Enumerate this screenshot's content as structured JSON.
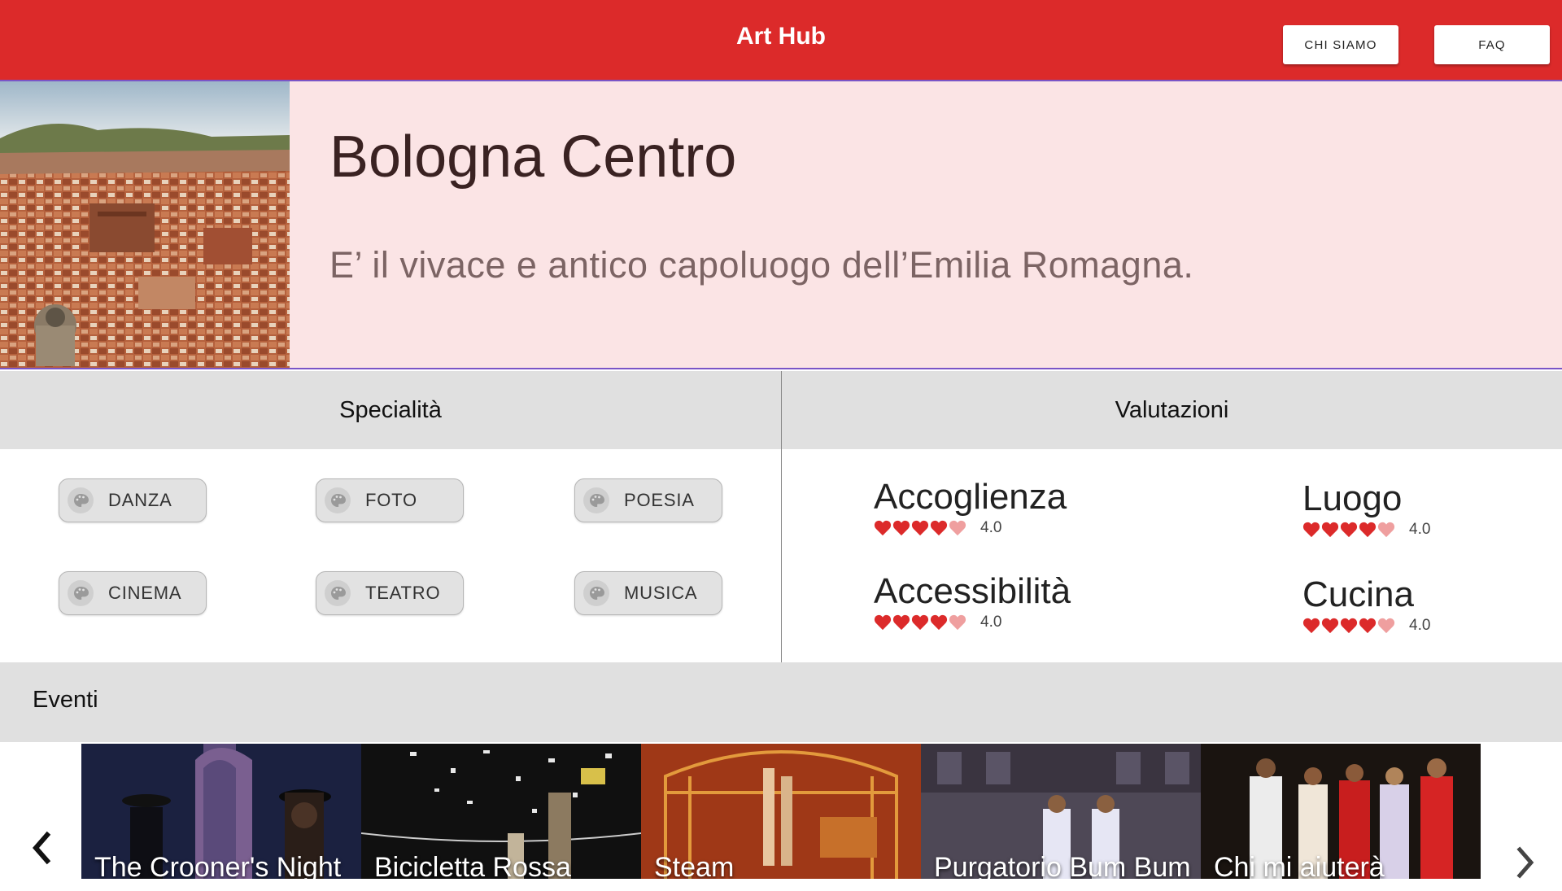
{
  "header": {
    "title": "Art Hub",
    "nav": {
      "chi_siamo": "CHI SIAMO",
      "faq": "FAQ"
    },
    "color": "#dc2a2a"
  },
  "hero": {
    "title": "Bologna Centro",
    "subtitle": "E’ il vivace e antico capoluogo dell’Emilia Romagna.",
    "background": "#fbe4e5",
    "image": "bologna-aerial-photo"
  },
  "specialita": {
    "heading": "Specialità",
    "chips": [
      {
        "label": "DANZA",
        "icon": "palette-icon"
      },
      {
        "label": "FOTO",
        "icon": "palette-icon"
      },
      {
        "label": "POESIA",
        "icon": "palette-icon"
      },
      {
        "label": "CINEMA",
        "icon": "palette-icon"
      },
      {
        "label": "TEATRO",
        "icon": "palette-icon"
      },
      {
        "label": "MUSICA",
        "icon": "palette-icon"
      }
    ]
  },
  "valutazioni": {
    "heading": "Valutazioni",
    "heart_color": "#dc2a2a",
    "items": [
      {
        "name": "Accoglienza",
        "value": "4.0",
        "rating": 4,
        "max": 5
      },
      {
        "name": "Luogo",
        "value": "4.0",
        "rating": 4,
        "max": 5
      },
      {
        "name": "Accessibilità",
        "value": "4.0",
        "rating": 4,
        "max": 5
      },
      {
        "name": "Cucina",
        "value": "4.0",
        "rating": 4,
        "max": 5
      }
    ]
  },
  "eventi": {
    "heading": "Eventi",
    "prev_icon": "chevron-left-icon",
    "next_icon": "chevron-right-icon",
    "items": [
      {
        "title": "The Crooner's Night"
      },
      {
        "title": "Bicicletta Rossa"
      },
      {
        "title": "Steam"
      },
      {
        "title": "Purgatorio Bum Bum"
      },
      {
        "title": "Chi mi aiuterà"
      }
    ]
  }
}
